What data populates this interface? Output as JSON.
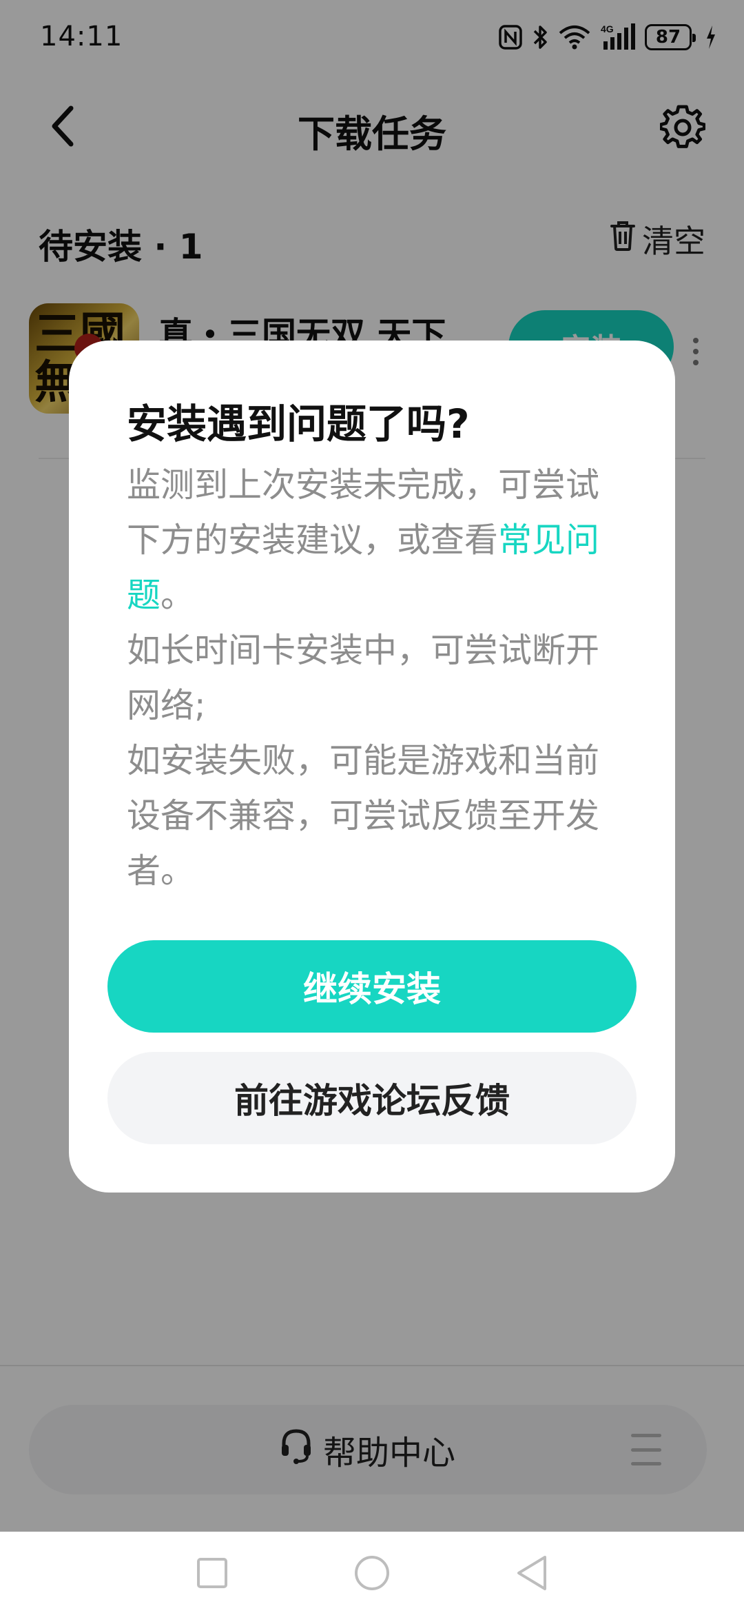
{
  "status_bar": {
    "time": "14:11",
    "network": "4G",
    "battery": "87",
    "icons": [
      "nfc-icon",
      "bluetooth-icon",
      "wifi-icon",
      "signal-4g-icon",
      "battery-icon",
      "charging-icon"
    ]
  },
  "header": {
    "title": "下载任务",
    "back_icon": "chevron-left-icon",
    "settings_icon": "gear-icon"
  },
  "section": {
    "title": "待安装 · 1",
    "clear_label": "清空",
    "clear_icon": "trash-icon"
  },
  "task": {
    "game_name": "真・三国无双 天下",
    "install_label": "安装",
    "more_icon": "more-vertical-icon"
  },
  "help": {
    "label": "帮助中心",
    "icon": "headset-icon",
    "menu_icon": "menu-icon"
  },
  "dialog": {
    "title": "安装遇到问题了吗?",
    "body_part1": "监测到上次安装未完成，可尝试下方的安装建议，或查看",
    "faq_link": "常见问题",
    "body_part2": "。",
    "body_line2": "如长时间卡安装中，可尝试断开网络;",
    "body_line3": "如安装失败，可能是游戏和当前设备不兼容，可尝试反馈至开发者。",
    "continue_label": "继续安装",
    "feedback_label": "前往游戏论坛反馈"
  },
  "nav_bar": {
    "icons": [
      "recents-square-icon",
      "home-circle-icon",
      "back-triangle-icon"
    ]
  },
  "colors": {
    "accent": "#17d6c2",
    "overlay": "rgba(0,0,0,0.40)",
    "secondary_button_bg": "#f3f4f6",
    "body_text": "#8d8d8d"
  }
}
